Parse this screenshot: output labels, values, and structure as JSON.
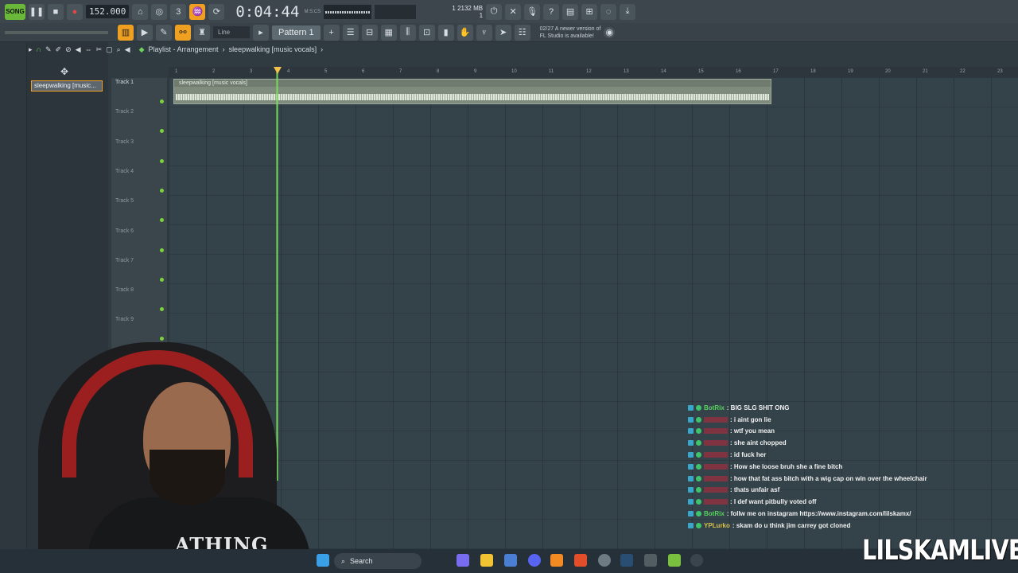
{
  "toolbar": {
    "song_mode": "SONG",
    "tempo": "152.000",
    "time": "0:04:44",
    "time_unit": "M:S:CS",
    "cpu_line1": "1",
    "memory": "2132 MB",
    "cpu_line2": "1"
  },
  "toolbar2": {
    "line_mode": "Line",
    "pattern": "Pattern 1",
    "news_date": "02/27",
    "news_line1": "A newer version of",
    "news_line2": "FL Studio is available!"
  },
  "channel": {
    "selected": "sleepwalking [music..."
  },
  "playlist": {
    "title": "Playlist - Arrangement",
    "separator": "›",
    "clip_name": "sleepwalking [music vocals]",
    "clip_label": "sleepwalking [music vocals]",
    "ruler": [
      "1",
      "2",
      "3",
      "4",
      "5",
      "6",
      "7",
      "8",
      "9",
      "10",
      "11",
      "12",
      "13",
      "14",
      "15",
      "16",
      "17",
      "18",
      "19",
      "20",
      "21",
      "22",
      "23"
    ],
    "tracks": [
      "Track 1",
      "Track 2",
      "Track 3",
      "Track 4",
      "Track 5",
      "Track 6",
      "Track 7",
      "Track 8",
      "Track 9"
    ]
  },
  "webcam": {
    "shirt_text": "ATHING"
  },
  "chat": [
    {
      "user": "BotRix",
      "user_color": "#59d35d",
      "message": ": BIG SLG SHIT ONG",
      "badge": "mod"
    },
    {
      "user": "",
      "user_color": "#c0283a",
      "message": ": i aint gon lie",
      "badge": "sub"
    },
    {
      "user": "",
      "user_color": "#c0283a",
      "message": ": wtf you mean",
      "badge": "sub"
    },
    {
      "user": "",
      "user_color": "#c0283a",
      "message": ": she aint chopped",
      "badge": "sub"
    },
    {
      "user": "",
      "user_color": "#c0283a",
      "message": ": id fuck her",
      "badge": "sub"
    },
    {
      "user": "",
      "user_color": "#c0283a",
      "message": ": How she loose bruh she a fine bitch",
      "badge": "sub"
    },
    {
      "user": "",
      "user_color": "#c0283a",
      "message": ": how that fat ass bitch with a wig cap on win over the wheelchair",
      "badge": "sub"
    },
    {
      "user": "",
      "user_color": "#c0283a",
      "message": ": thats unfair asf",
      "badge": "sub"
    },
    {
      "user": "",
      "user_color": "#c0283a",
      "message": ": I def want pitbully voted off",
      "badge": "sub"
    },
    {
      "user": "BotRix",
      "user_color": "#59d35d",
      "message": ": follw me on instagram https://www.instagram.com/lilskamx/",
      "badge": "mod"
    },
    {
      "user": "YPLurko",
      "user_color": "#d6c24a",
      "message": ": skam do u think jim carrey got cloned",
      "badge": "mod"
    }
  ],
  "taskbar": {
    "search_placeholder": "Search"
  },
  "watermark": "LILSKAMLIVE",
  "colors": {
    "accent": "#f0a020",
    "playhead": "#7ee05a",
    "clip": "#7e8b7d"
  }
}
